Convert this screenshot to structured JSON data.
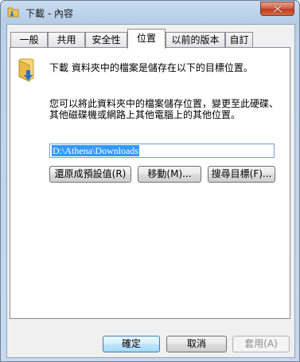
{
  "window": {
    "title": "下載 - 內容",
    "icon": "folder-download-icon"
  },
  "tabs": [
    {
      "label": "一般"
    },
    {
      "label": "共用"
    },
    {
      "label": "安全性"
    },
    {
      "label": "位置",
      "active": true
    },
    {
      "label": "以前的版本"
    },
    {
      "label": "自訂"
    }
  ],
  "location": {
    "description": "下載 資料夾中的檔案是儲存在以下的目標位置。",
    "help": "您可以將此資料夾中的檔案儲存位置，變更至此硬碟、其他磁碟機或網路上其他電腦上的其他位置。",
    "path": "D:\\Athena\\Downloads",
    "restore_default": "還原成預設值(R)",
    "move": "移動(M)...",
    "find_target": "搜尋目標(F)..."
  },
  "footer": {
    "ok": "確定",
    "cancel": "取消",
    "apply": "套用(A)"
  },
  "colors": {
    "title_gradient": "#bcd2ea",
    "selection": "#3399ff",
    "close_button": "#c2391f"
  }
}
